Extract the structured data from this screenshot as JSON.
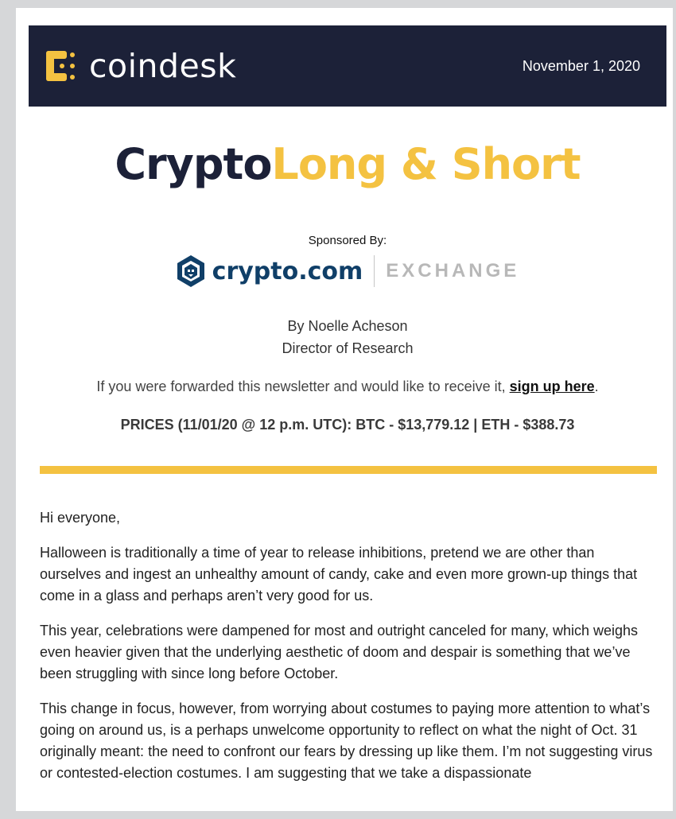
{
  "header": {
    "brand_name": "coindesk",
    "date": "November 1, 2020",
    "brand_color": "#1c2138",
    "logo_color": "#f4c241"
  },
  "newsletter": {
    "title_part1": "Crypto",
    "title_part2": "Long & Short",
    "title_color_1": "#1c2138",
    "title_color_2": "#f4c241"
  },
  "sponsor": {
    "label": "Sponsored By:",
    "name": "crypto.com",
    "suffix": "EXCHANGE",
    "name_color": "#103f68"
  },
  "byline": {
    "author": "By Noelle Acheson",
    "role": "Director of Research"
  },
  "forward_note": {
    "text": "If you were forwarded this newsletter and would like to receive it, ",
    "link_text": "sign up here",
    "trailing": "."
  },
  "prices": {
    "text": "PRICES (11/01/20 @ 12 p.m. UTC):  BTC - $13,779.12 | ETH - $388.73"
  },
  "body": {
    "paragraphs": [
      "Hi everyone,",
      "Halloween is traditionally a time of year to release inhibitions, pretend we are other than ourselves and ingest an unhealthy amount of candy, cake and even more grown-up things that come in a glass and perhaps aren’t very good for us.",
      "This year, celebrations were dampened for most and outright canceled for many, which weighs even heavier given that the underlying aesthetic of doom and despair is something that we’ve been struggling with since long before October.",
      "This change in focus, however, from worrying about costumes to paying more attention to what’s going on around us, is a perhaps unwelcome opportunity to reflect on what the night of Oct. 31 originally meant: the need to confront our fears by dressing up like them. I’m not suggesting virus or contested-election costumes. I am suggesting that we take a dispassionate"
    ]
  }
}
